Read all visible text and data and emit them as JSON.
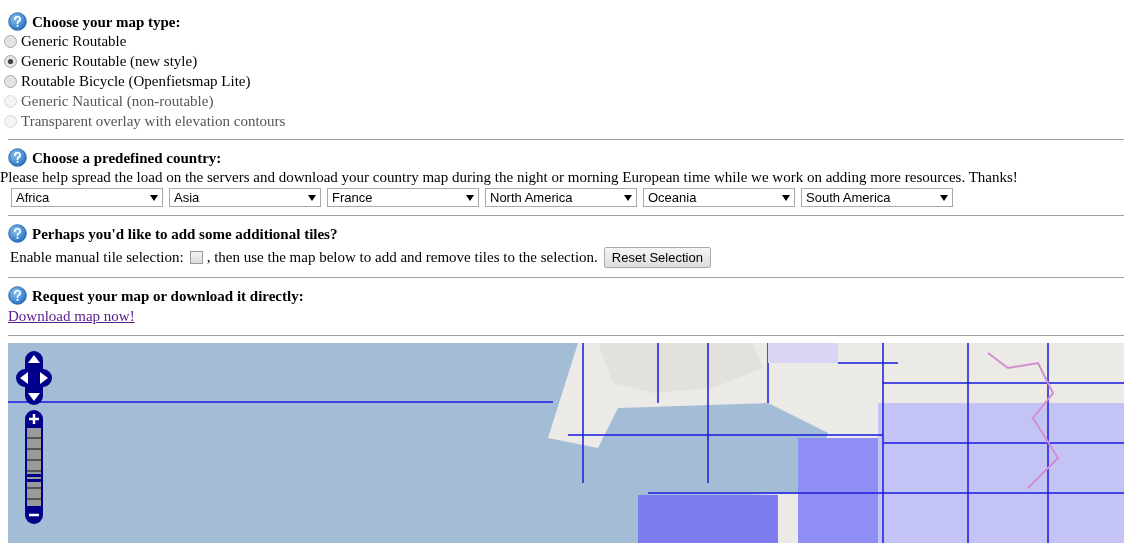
{
  "map_type": {
    "heading": "Choose your map type:",
    "options": [
      {
        "label": "Generic Routable",
        "selected": false,
        "disabled": false
      },
      {
        "label": "Generic Routable (new style)",
        "selected": true,
        "disabled": false
      },
      {
        "label": "Routable Bicycle (Openfietsmap Lite)",
        "selected": false,
        "disabled": false
      },
      {
        "label": "Generic Nautical (non-routable)",
        "selected": false,
        "disabled": true
      },
      {
        "label": "Transparent overlay with elevation contours",
        "selected": false,
        "disabled": true
      }
    ]
  },
  "country": {
    "heading": "Choose a predefined country:",
    "note": "Please help spread the load on the servers and download your country map during the night or morning European time while we work on adding more resources. Thanks!",
    "dropdowns": [
      "Africa",
      "Asia",
      "France",
      "North America",
      "Oceania",
      "South America"
    ]
  },
  "tiles": {
    "heading": "Perhaps you'd like to add some additional tiles?",
    "label_before": "Enable manual tile selection:",
    "checked": false,
    "label_after": ", then use the map below to add and remove tiles to the selection.",
    "button": "Reset Selection"
  },
  "request": {
    "heading": "Request your map or download it directly:",
    "link": "Download map now!"
  },
  "map": {
    "kind": "picture",
    "zoom": {
      "level": 0.36
    }
  }
}
